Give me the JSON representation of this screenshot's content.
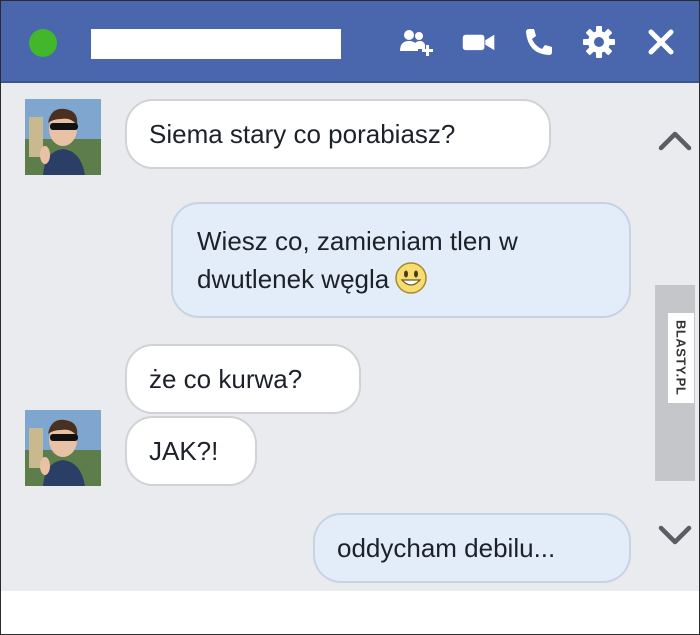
{
  "header": {
    "contact_name": "",
    "icons": [
      "add-friend-icon",
      "video-call-icon",
      "phone-icon",
      "gear-icon",
      "close-icon"
    ],
    "bar_color": "#4a67ad",
    "status_color": "#42b72a"
  },
  "messages": [
    {
      "from": "contact",
      "text": "Siema stary co porabiasz?"
    },
    {
      "from": "me",
      "line1": "Wiesz co, zamieniam tlen w",
      "line2": "dwutlenek węgla",
      "emoji": "smiley-icon"
    },
    {
      "from": "contact",
      "text": "że co kurwa?"
    },
    {
      "from": "contact",
      "text": "JAK?!"
    },
    {
      "from": "me",
      "text": "oddycham debilu..."
    }
  ],
  "watermark": "BLASTY.PL",
  "colors": {
    "outgoing_bubble": "#e3edf9",
    "incoming_bubble": "#ffffff",
    "chat_bg": "#e9ebee"
  }
}
